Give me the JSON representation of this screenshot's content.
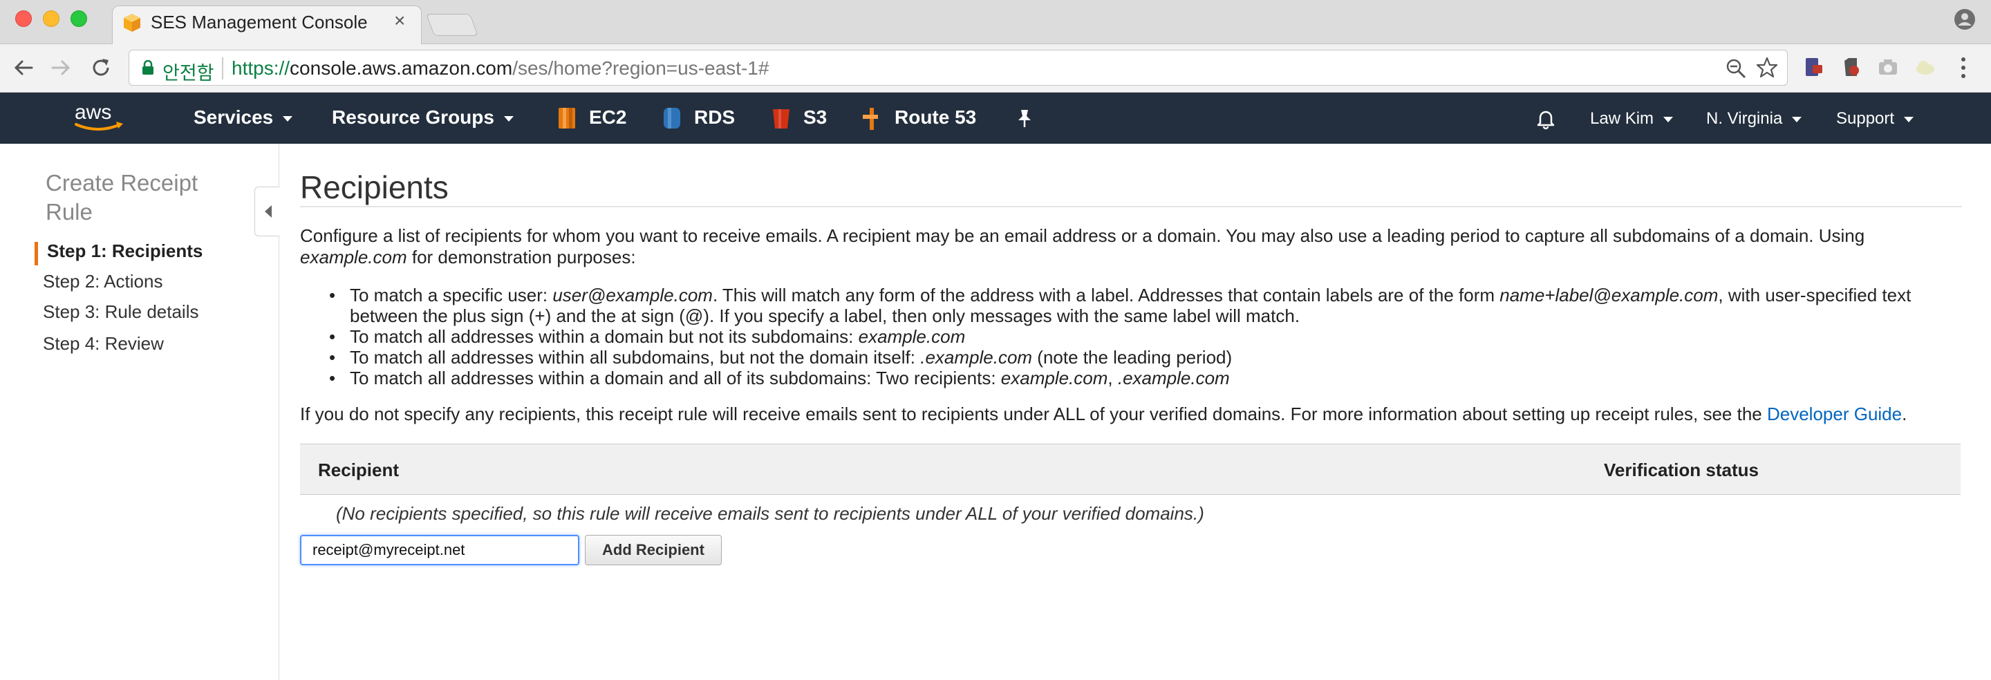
{
  "browser": {
    "tab_title": "SES Management Console",
    "tab_close": "×",
    "secure_label": "안전함",
    "url_proto": "https://",
    "url_host": "console.aws.amazon.com",
    "url_path": "/ses/home?region=us-east-1#"
  },
  "aws_nav": {
    "logo": "aws",
    "services": "Services",
    "resource_groups": "Resource Groups",
    "shortcuts": [
      {
        "label": "EC2",
        "icon": "ec2-icon",
        "color": "#e47911"
      },
      {
        "label": "RDS",
        "icon": "rds-icon",
        "color": "#2e73b8"
      },
      {
        "label": "S3",
        "icon": "s3-icon",
        "color": "#d13212"
      },
      {
        "label": "Route 53",
        "icon": "route53-icon",
        "color": "#e47911"
      }
    ],
    "user": "Law Kim",
    "region": "N. Virginia",
    "support": "Support"
  },
  "sidebar": {
    "title": "Create Receipt Rule",
    "steps": [
      {
        "label": "Step 1: Recipients",
        "active": true
      },
      {
        "label": "Step 2: Actions",
        "active": false
      },
      {
        "label": "Step 3: Rule details",
        "active": false
      },
      {
        "label": "Step 4: Review",
        "active": false
      }
    ],
    "accent_color": "#ec7211"
  },
  "main": {
    "title": "Recipients",
    "intro_text": "Configure a list of recipients for whom you want to receive emails. A recipient may be an email address or a domain. You may also use a leading period to capture all subdomains of a domain. Using ",
    "intro_example": "example.com",
    "intro_tail": " for demonstration purposes:",
    "bullets": [
      {
        "a": "To match a specific user: ",
        "a_em": "user@example.com",
        "b": ". This will match any form of the address with a label. Addresses that contain labels are of the form ",
        "b_em": "name+label@example.com",
        "c": ", with user-specified text between the plus sign (+) and the at sign (@). If you specify a label, then only messages with the same label will match."
      },
      {
        "a": "To match all addresses within a domain but not its subdomains: ",
        "a_em": "example.com"
      },
      {
        "a": "To match all addresses within all subdomains, but not the domain itself: ",
        "a_em": ".example.com",
        "b": " (note the leading period)"
      },
      {
        "a": "To match all addresses within a domain and all of its subdomains: Two recipients: ",
        "a_em": "example.com",
        "b": ", ",
        "b_em": ".example.com"
      }
    ],
    "footnote_text": "If you do not specify any recipients, this receipt rule will receive emails sent to recipients under ALL of your verified domains. For more information about setting up receipt rules, see the ",
    "footnote_link": "Developer Guide",
    "footnote_end": ".",
    "table": {
      "col_recipient": "Recipient",
      "col_status": "Verification status",
      "empty_message": "(No recipients specified, so this rule will receive emails sent to recipients under ALL of your verified domains.)"
    },
    "recipient_input_value": "receipt@myreceipt.net",
    "add_button": "Add Recipient",
    "link_color": "#0066c0"
  }
}
